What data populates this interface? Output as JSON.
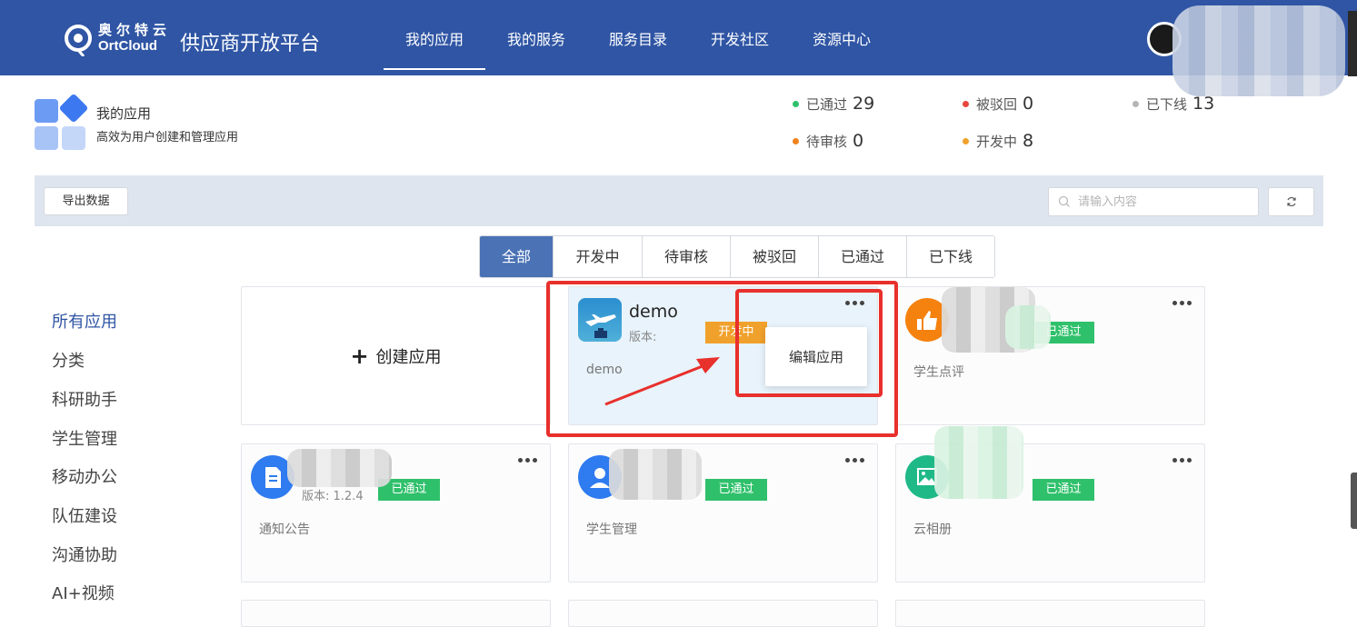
{
  "header": {
    "logo_cn": "奥尔特云",
    "logo_en": "OrtCloud",
    "platform_title": "供应商开放平台",
    "nav": [
      "我的应用",
      "我的服务",
      "服务目录",
      "开发社区",
      "资源中心"
    ],
    "nav_active": 0
  },
  "summary": {
    "title": "我的应用",
    "description": "高效为用户创建和管理应用",
    "stats": [
      {
        "label": "已通过",
        "value": "29",
        "color": "#2fc06b"
      },
      {
        "label": "被驳回",
        "value": "0",
        "color": "#e8453c"
      },
      {
        "label": "已下线",
        "value": "13",
        "color": "#b5b5b5"
      },
      {
        "label": "待审核",
        "value": "0",
        "color": "#f0821c"
      },
      {
        "label": "开发中",
        "value": "8",
        "color": "#f0a12c"
      }
    ]
  },
  "toolbar": {
    "export_label": "导出数据",
    "search_placeholder": "请输入内容"
  },
  "tabs": [
    "全部",
    "开发中",
    "待审核",
    "被驳回",
    "已通过",
    "已下线"
  ],
  "sidebar": {
    "items": [
      "所有应用",
      "分类",
      "科研助手",
      "学生管理",
      "移动办公",
      "队伍建设",
      "沟通协助",
      "AI+视频"
    ]
  },
  "cards": {
    "create_label": "创建应用",
    "demo": {
      "name": "demo",
      "version_label": "版本:",
      "status": "开发中",
      "desc": "demo"
    },
    "popup_item": "编辑应用",
    "apps": [
      {
        "status": "已通过",
        "desc": "学生点评",
        "icon": "thumbs-up-icon"
      },
      {
        "status": "已通过",
        "desc": "通知公告",
        "version": "版本: 1.2.4",
        "icon": "document-icon"
      },
      {
        "status": "已通过",
        "desc": "学生管理",
        "icon": "student-icon"
      },
      {
        "status": "已通过",
        "desc": "云相册",
        "icon": "image-icon"
      }
    ]
  },
  "colors": {
    "header_bg": "#2f55a4",
    "tab_active": "#4a72b5",
    "status_green": "#2fc06b",
    "status_orange": "#f0a12c",
    "annotation_red": "#e8302c"
  }
}
